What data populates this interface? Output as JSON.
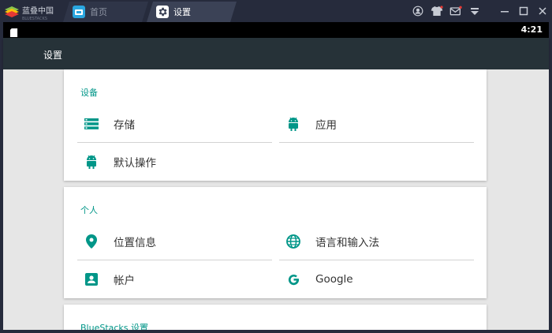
{
  "window": {
    "logo_text": "蓝叠中国",
    "logo_sub": "BLUESTACKS",
    "tabs": [
      {
        "label": "首页",
        "active": false
      },
      {
        "label": "设置",
        "active": true
      }
    ]
  },
  "status": {
    "time": "4:21"
  },
  "actionbar": {
    "title": "设置"
  },
  "sections": [
    {
      "title": "设备",
      "items": [
        {
          "label": "存储",
          "icon": "storage-icon"
        },
        {
          "label": "应用",
          "icon": "android-icon"
        },
        {
          "label": "默认操作",
          "icon": "android-icon"
        }
      ]
    },
    {
      "title": "个人",
      "items": [
        {
          "label": "位置信息",
          "icon": "location-pin-icon"
        },
        {
          "label": "语言和输入法",
          "icon": "globe-icon"
        },
        {
          "label": "帐户",
          "icon": "account-icon"
        },
        {
          "label": "Google",
          "icon": "google-g-icon"
        }
      ]
    },
    {
      "title": "BlueStacks 设置"
    }
  ],
  "colors": {
    "accent": "#009688",
    "actionbar": "#263238",
    "window_chrome": "#262b3c",
    "background": "#e6e6e6"
  }
}
